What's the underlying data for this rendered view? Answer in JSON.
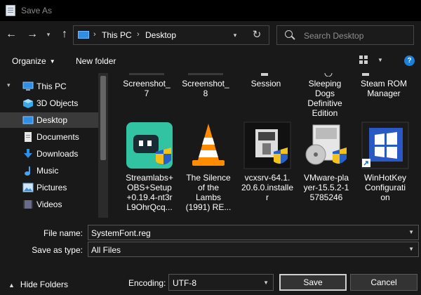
{
  "window": {
    "title": "Save As"
  },
  "nav": {
    "back_icon": "arrow-left-icon",
    "forward_icon": "arrow-right-icon",
    "recent_icon": "chevron-down-icon",
    "up_icon": "arrow-up-icon",
    "breadcrumbs": [
      "This PC",
      "Desktop"
    ],
    "refresh_icon": "refresh-icon",
    "search_placeholder": "Search Desktop"
  },
  "toolbar": {
    "organize_label": "Organize",
    "new_folder_label": "New folder",
    "help_label": "?"
  },
  "sidebar": {
    "items": [
      {
        "label": "This PC",
        "icon": "computer-icon",
        "selected": false
      },
      {
        "label": "3D Objects",
        "icon": "cube-icon",
        "selected": false
      },
      {
        "label": "Desktop",
        "icon": "desktop-icon",
        "selected": true
      },
      {
        "label": "Documents",
        "icon": "document-icon",
        "selected": false
      },
      {
        "label": "Downloads",
        "icon": "download-icon",
        "selected": false
      },
      {
        "label": "Music",
        "icon": "music-icon",
        "selected": false
      },
      {
        "label": "Pictures",
        "icon": "picture-icon",
        "selected": false
      },
      {
        "label": "Videos",
        "icon": "video-icon",
        "selected": false
      }
    ]
  },
  "content": {
    "top_row": [
      {
        "name": "Screenshot_\n7"
      },
      {
        "name": "Screenshot_\n8"
      },
      {
        "name": "Session"
      },
      {
        "name": "Sleeping\nDogs\nDefinitive\nEdition"
      },
      {
        "name": "Steam ROM\nManager"
      }
    ],
    "files": [
      {
        "name": "Streamlabs+\nOBS+Setup\n+0.19.4-nt3r\nL9OhrQcq...",
        "icon": "streamlabs-installer-icon"
      },
      {
        "name": "The Silence\nof the\nLambs\n(1991) RE...",
        "icon": "vlc-cone-icon"
      },
      {
        "name": "vcxsrv-64.1.\n20.6.0.installe\nr",
        "icon": "installer-icon"
      },
      {
        "name": "VMware-pla\nyer-15.5.2-1\n5785246",
        "icon": "vmware-installer-icon"
      },
      {
        "name": "WinHotKey\nConfigurati\non",
        "icon": "windows-shortcut-icon"
      }
    ]
  },
  "form": {
    "file_name_label": "File name:",
    "file_name_value": "SystemFont.reg",
    "save_as_type_label": "Save as type:",
    "save_as_type_value": "All Files",
    "hide_folders_label": "Hide Folders",
    "encoding_label": "Encoding:",
    "encoding_value": "UTF-8",
    "save_label": "Save",
    "cancel_label": "Cancel"
  }
}
